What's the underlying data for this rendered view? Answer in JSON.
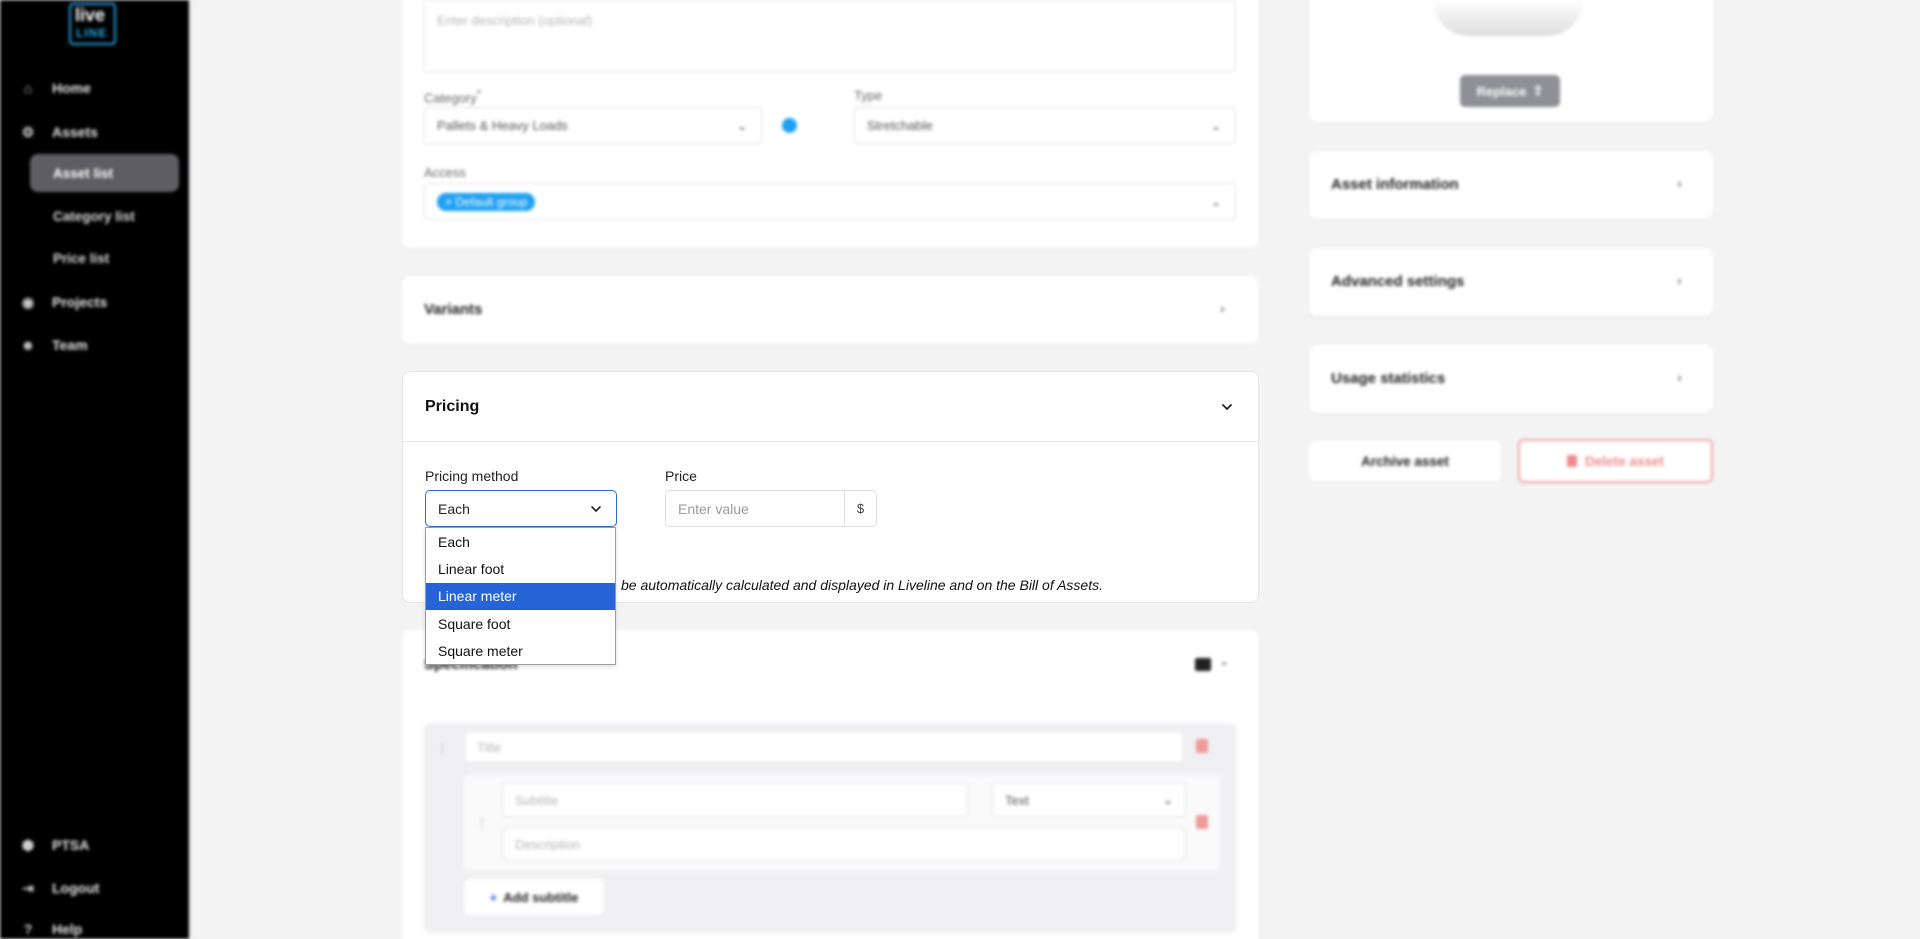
{
  "app": {
    "logo_top": "live",
    "logo_bottom": "LINE"
  },
  "sidebar": {
    "items": [
      {
        "label": "Home",
        "icon": "home-icon"
      },
      {
        "label": "Assets",
        "icon": "assets-icon"
      },
      {
        "label": "Asset list"
      },
      {
        "label": "Category list"
      },
      {
        "label": "Price list"
      },
      {
        "label": "Projects",
        "icon": "projects-icon"
      },
      {
        "label": "Team",
        "icon": "team-icon"
      }
    ],
    "bottom": [
      {
        "label": "PTSA",
        "icon": "ptsa-icon"
      },
      {
        "label": "Logout",
        "icon": "logout-icon"
      },
      {
        "label": "Help",
        "icon": "help-icon"
      }
    ]
  },
  "details": {
    "description_placeholder": "Enter description (optional)",
    "category_label": "Category",
    "category_value": "Pallets & Heavy Loads",
    "type_label": "Type",
    "type_value": "Stretchable",
    "access_label": "Access",
    "access_tag": "Default group"
  },
  "variants": {
    "title": "Variants"
  },
  "pricing": {
    "title": "Pricing",
    "method_label": "Pricing method",
    "method_value": "Each",
    "price_label": "Price",
    "price_placeholder": "Enter value",
    "currency": "$",
    "note": "be automatically calculated and displayed in Liveline and on the Bill of Assets.",
    "options": [
      "Each",
      "Linear foot",
      "Linear meter",
      "Square foot",
      "Square meter"
    ],
    "highlighted_option": "Linear meter"
  },
  "specification": {
    "title": "Specification",
    "title_placeholder": "Title",
    "subtitle_placeholder": "Subtitle",
    "subtitle_type": "Text",
    "description_placeholder": "Description",
    "add_subtitle": "Add subtitle"
  },
  "right_panel": {
    "replace_button": "Replace",
    "asset_information": "Asset information",
    "advanced_settings": "Advanced settings",
    "usage_statistics": "Usage statistics",
    "archive_button": "Archive asset",
    "delete_button": "Delete asset"
  },
  "colors": {
    "accent": "#2563d6",
    "danger": "#e86a6a",
    "sidebar_bg": "#000000",
    "tag_bg": "#1ea1f2"
  }
}
